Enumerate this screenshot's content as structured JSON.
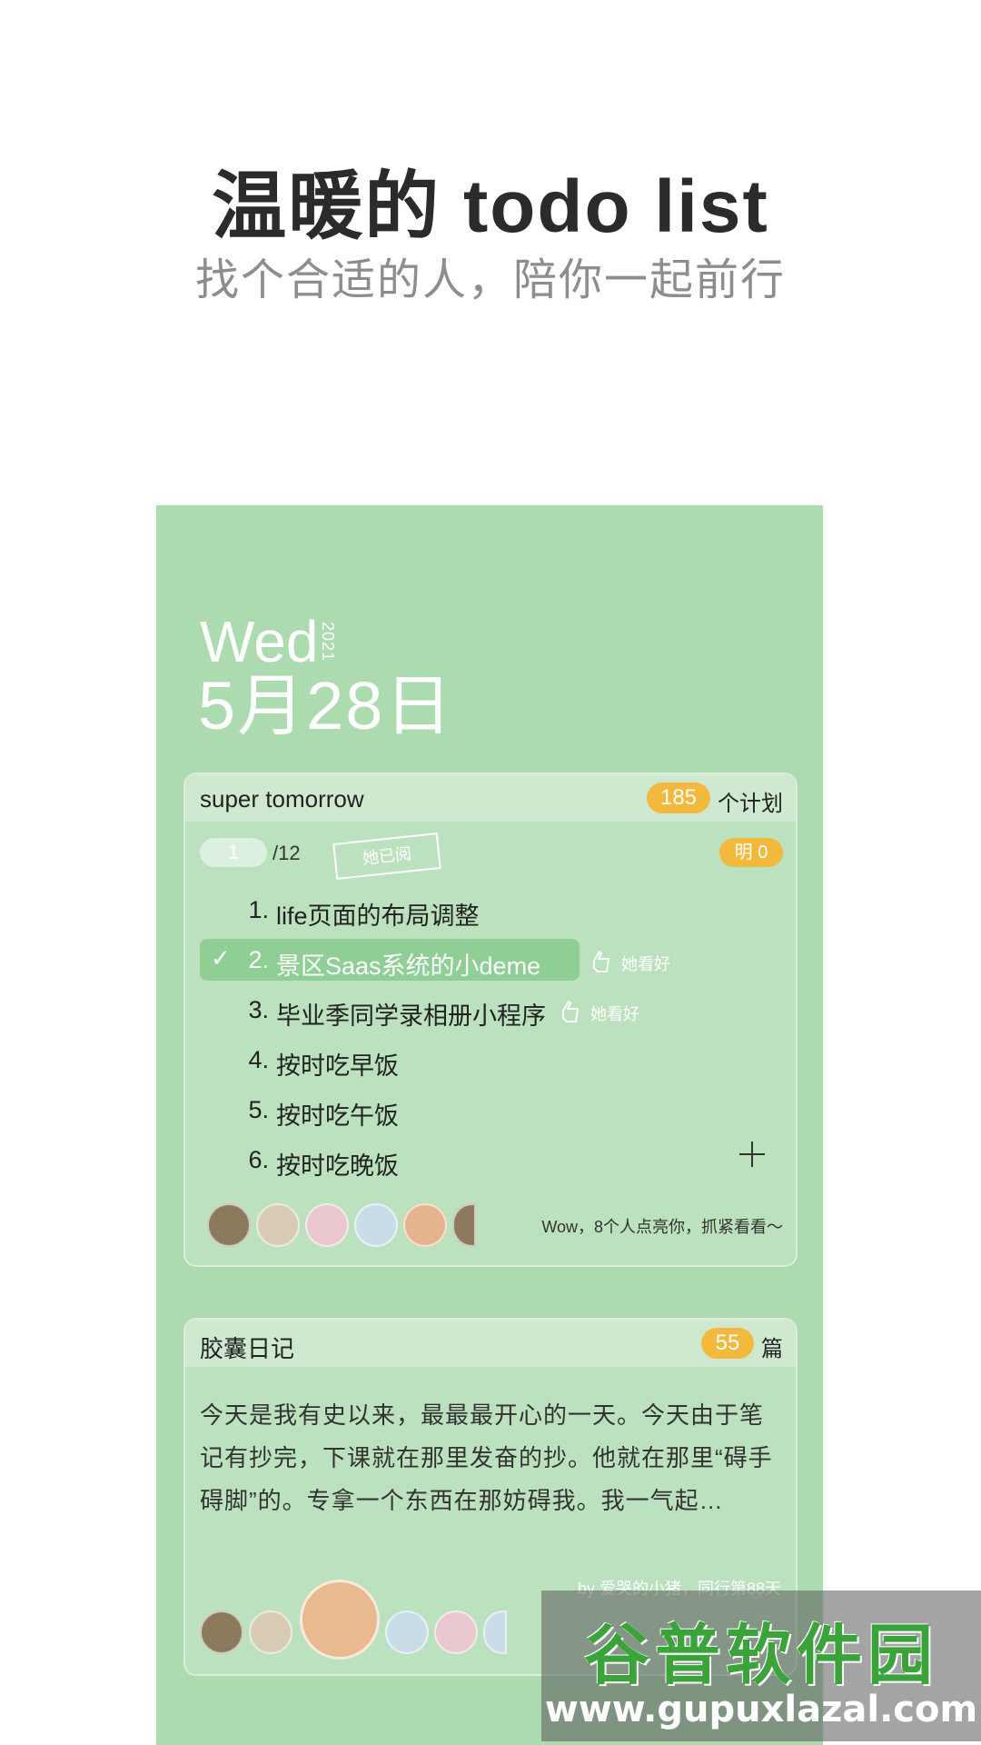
{
  "header": {
    "title": "温暖的 todo list",
    "subtitle": "找个合适的人，陪你一起前行"
  },
  "date": {
    "weekday": "Wed",
    "year": "2021",
    "date": "5月28日"
  },
  "todo_card": {
    "title": "super tomorrow",
    "plan_count": "185",
    "plan_suffix": "个计划",
    "progress_done": "1",
    "progress_total": "/12",
    "read_stamp": "她已阅",
    "tomorrow_badge": "明 0",
    "items": [
      {
        "num": "1.",
        "text": "life页面的布局调整",
        "done": false,
        "like": ""
      },
      {
        "num": "2.",
        "text": "景区Saas系统的小deme",
        "done": true,
        "like": "她看好"
      },
      {
        "num": "3.",
        "text": "毕业季同学录相册小程序",
        "done": false,
        "like": "她看好"
      },
      {
        "num": "4.",
        "text": "按时吃早饭",
        "done": false,
        "like": ""
      },
      {
        "num": "5.",
        "text": "按时吃午饭",
        "done": false,
        "like": ""
      },
      {
        "num": "6.",
        "text": "按时吃晚饭",
        "done": false,
        "like": ""
      }
    ],
    "fans_text": "Wow，8个人点亮你，抓紧看看～"
  },
  "diary_card": {
    "title": "胶囊日记",
    "count": "55",
    "count_suffix": "篇",
    "body": "今天是我有史以来，最最最开心的一天。今天由于笔记有抄完，下课就在那里发奋的抄。他就在那里“碍手碍脚”的。专拿一个东西在那妨碍我。我一气起…",
    "byline": "by 爱哭的小猪，同行第88天"
  },
  "watermark": {
    "main": "谷普软件园",
    "url": "www.gupuxlazal.com"
  },
  "colors": {
    "panel": "#acdbb0",
    "accent": "#f3b93d",
    "highlight": "#8fcf95"
  }
}
